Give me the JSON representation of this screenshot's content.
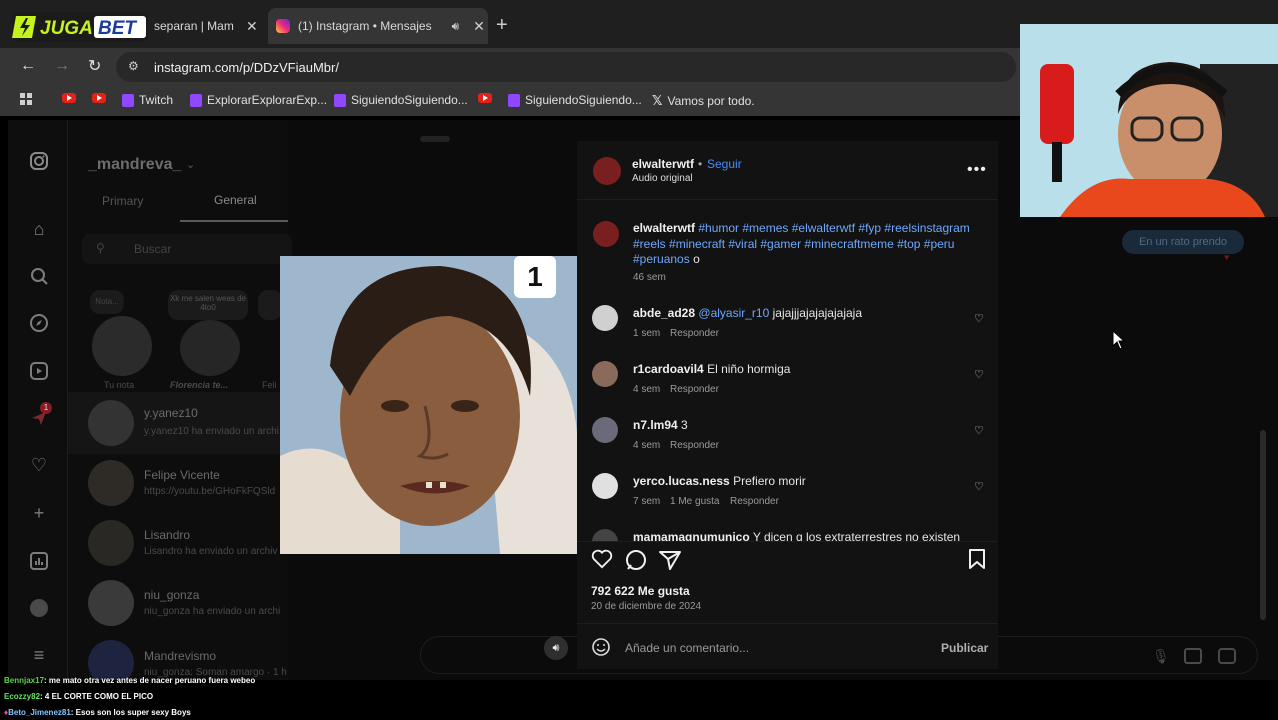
{
  "browser": {
    "logo_text": "JUGABET",
    "tabs": [
      {
        "label": "separan | Mam"
      },
      {
        "label": "(1) Instagram • Mensajes"
      }
    ],
    "url": "instagram.com/p/DDzVFiauMbr/",
    "bookmarks": [
      {
        "label": "Twitch"
      },
      {
        "label": "ExplorarExplorarExp..."
      },
      {
        "label": "SiguiendoSiguiendo..."
      },
      {
        "label": "SiguiendoSiguiendo..."
      },
      {
        "label": "Vamos por todo."
      }
    ]
  },
  "dm": {
    "account": "_mandreva_",
    "tabs": [
      "Primary",
      "General"
    ],
    "search_placeholder": "Buscar",
    "notes": [
      {
        "bubble": "Nota...",
        "caption": "Tu nota"
      },
      {
        "bubble": "Xk me salen weas de 4to0",
        "caption": "Florencia te..."
      },
      {
        "bubble": "",
        "caption": "Feli"
      }
    ],
    "threads": [
      {
        "name": "y.yanez10",
        "preview": "y.yanez10 ha enviado un archi"
      },
      {
        "name": "Felipe Vicente",
        "preview": "https://youtu.be/GHoFkFQSld"
      },
      {
        "name": "Lisandro",
        "preview": "Lisandro ha enviado un archiv"
      },
      {
        "name": "niu_gonza",
        "preview": "niu_gonza ha enviado un archi"
      },
      {
        "name": "Mandrevismo",
        "preview": "niu_gonza: Soman amargo · 1 h"
      }
    ],
    "notification_badge": "1"
  },
  "chat_bg": {
    "bubble": "En un rato prendo"
  },
  "post": {
    "image_badge": "1",
    "author": "elwalterwtf",
    "follow": "Seguir",
    "audio": "Audio original",
    "caption_user": "elwalterwtf",
    "caption_tags": "#humor #memes #elwalterwtf #fyp #reelsinstagram #reels #minecraft #viral #gamer #minecraftmeme #top #peru #peruanos",
    "caption_end": "o",
    "caption_time": "46 sem",
    "comments": [
      {
        "user": "abde_ad28",
        "mention": "@alyasir_r10",
        "text": "jajajjjajajajajajaja",
        "time": "1 sem",
        "likes": "",
        "reply": "Responder"
      },
      {
        "user": "r1cardoavil4",
        "mention": "",
        "text": "El niño hormiga",
        "time": "4 sem",
        "likes": "",
        "reply": "Responder"
      },
      {
        "user": "n7.lm94",
        "mention": "",
        "text": "3",
        "time": "4 sem",
        "likes": "",
        "reply": "Responder"
      },
      {
        "user": "yerco.lucas.ness",
        "mention": "",
        "text": "Prefiero morir",
        "time": "7 sem",
        "likes": "1 Me gusta",
        "reply": "Responder"
      },
      {
        "user": "mamamagnumunico",
        "mention": "",
        "text": "Y dicen q los extraterrestres no existen",
        "time": "",
        "likes": "",
        "reply": ""
      }
    ],
    "likes": "792 622 Me gusta",
    "date": "20 de diciembre de 2024",
    "comment_placeholder": "Añade un comentario...",
    "publish": "Publicar"
  },
  "stream_chat": [
    {
      "user": "Bennjax17",
      "msg": ": me mato otra vez antes de nacer peruano fuera webeo"
    },
    {
      "user": "Ecozzy82",
      "msg": ": 4 EL CORTE COMO EL PICO"
    },
    {
      "user": "Beto_Jimenez81",
      "msg": ": Esos son los super sexy Boys"
    }
  ],
  "colors": {
    "accent_link": "#6ea8ff",
    "follow": "#4a8cff",
    "twitch": "#9146ff",
    "youtube": "#e62117",
    "jugabet_green": "#c6f21e"
  }
}
